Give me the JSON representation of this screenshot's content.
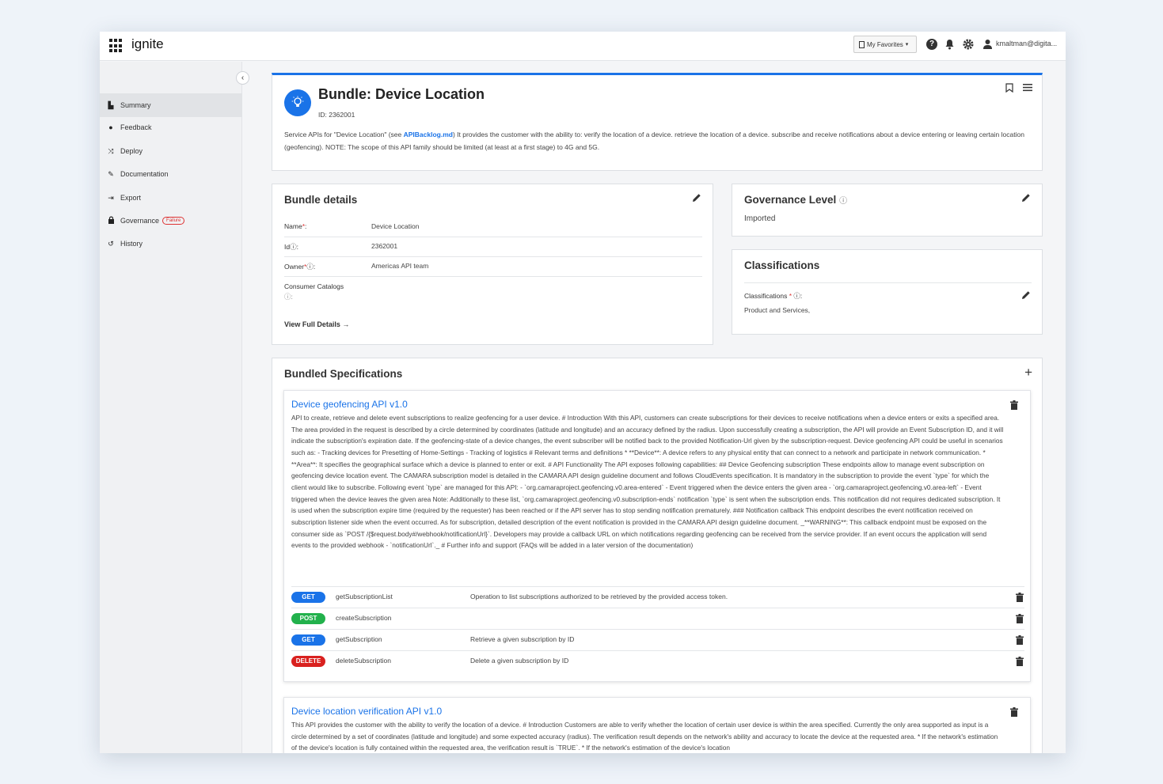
{
  "topbar": {
    "brand": "ignite",
    "favorites_label": "My Favorites",
    "user_name": "kmaltman@digita..."
  },
  "sidebar": {
    "items": [
      {
        "label": "Summary",
        "icon": "file-icon",
        "active": true
      },
      {
        "label": "Feedback",
        "icon": "comment-icon"
      },
      {
        "label": "Deploy",
        "icon": "shuffle-icon"
      },
      {
        "label": "Documentation",
        "icon": "paperclip-icon"
      },
      {
        "label": "Export",
        "icon": "export-icon"
      },
      {
        "label": "Governance",
        "icon": "lock-icon",
        "badge": "Failure"
      },
      {
        "label": "History",
        "icon": "history-icon"
      }
    ]
  },
  "hero": {
    "title": "Bundle: Device Location",
    "id_text": "ID: 2362001",
    "desc_prefix": "Service APIs for \"Device Location\" (see ",
    "desc_link": "APIBacklog.md",
    "desc_suffix": ") It provides the customer with the ability to: verify the location of a device. retrieve the location of a device. subscribe and receive notifications about a device entering or leaving certain location (geofencing). NOTE: The scope of this API family should be limited (at least at a first stage) to 4G and 5G."
  },
  "bundle_details": {
    "title": "Bundle details",
    "rows": [
      {
        "label": "Name",
        "required": "*",
        "help": "",
        "suffix": ":",
        "value": "Device Location"
      },
      {
        "label": "Id",
        "required": "",
        "help": "ⓘ",
        "suffix": ":",
        "value": "2362001"
      },
      {
        "label": "Owner",
        "required": "*",
        "help": "ⓘ",
        "suffix": ":",
        "value": "Americas API team"
      },
      {
        "label": "Consumer Catalogs",
        "required": "",
        "help": "ⓘ",
        "suffix": ":",
        "value": ""
      }
    ],
    "view_full": "View Full Details →"
  },
  "governance": {
    "title": "Governance Level",
    "help": "ⓘ",
    "value": "Imported"
  },
  "classifications": {
    "title": "Classifications",
    "label": "Classifications",
    "required": "*",
    "help": "ⓘ",
    "suffix": ":",
    "value": "Product and Services,"
  },
  "bundled_specs": {
    "title": "Bundled Specifications",
    "specs": [
      {
        "name": "Device geofencing API",
        "version": "v1.0",
        "description": "API to create, retrieve and delete event subscriptions to realize geofencing for a user device. # Introduction With this API, customers can create subscriptions for their devices to receive notifications when a device enters or exits a specified area. The area provided in the request is described by a circle determined by coordinates (latitude and longitude) and an accuracy defined by the radius. Upon successfully creating a subscription, the API will provide an Event Subscription ID, and it will indicate the subscription's expiration date. If the geofencing-state of a device changes, the event subscriber will be notified back to the provided Notification-Url given by the subscription-request. Device geofencing API could be useful in scenarios such as: - Tracking devices for Presetting of Home-Settings - Tracking of logistics # Relevant terms and definitions * **Device**: A device refers to any physical entity that can connect to a network and participate in network communication. * **Area**: It specifies the geographical surface which a device is planned to enter or exit. # API Functionality The API exposes following capabilities: ## Device Geofencing subscription These endpoints allow to manage event subscription on geofencing device location event. The CAMARA subscription model is detailed in the CAMARA API design guideline document and follows CloudEvents specification. It is mandatory in the subscription to provide the event `type` for which the client would like to subscribe. Following event `type` are managed for this API: - `org.camaraproject.geofencing.v0.area-entered` - Event triggered when the device enters the given area - `org.camaraproject.geofencing.v0.area-left` - Event triggered when the device leaves the given area Note: Additionally to these list, `org.camaraproject.geofencing.v0.subscription-ends` notification `type` is sent when the subscription ends. This notification did not requires dedicated subscription. It is used when the subscription expire time (required by the requester) has been reached or if the API server has to stop sending notification prematurely. ### Notification callback This endpoint describes the event notification received on subscription listener side when the event occurred. As for subscription, detailed description of the event notification is provided in the CAMARA API design guideline document. _**WARNING**: This callback endpoint must be exposed on the consumer side as `POST /{$request.body#/webhook/notificationUrl}`. Developers may provide a callback URL on which notifications regarding geofencing can be received from the service provider. If an event occurs the application will send events to the provided webhook - `notificationUrl`._ # Further info and support (FAQs will be added in a later version of the documentation)",
        "operations": [
          {
            "method": "GET",
            "name": "getSubscriptionList",
            "desc": "Operation to list subscriptions authorized to be retrieved by the provided access token."
          },
          {
            "method": "POST",
            "name": "createSubscription",
            "desc": ""
          },
          {
            "method": "GET",
            "name": "getSubscription",
            "desc": "Retrieve a given subscription by ID"
          },
          {
            "method": "DELETE",
            "name": "deleteSubscription",
            "desc": "Delete a given subscription by ID"
          }
        ]
      },
      {
        "name": "Device location verification API",
        "version": "v1.0",
        "description": "This API provides the customer with the ability to verify the location of a device. # Introduction Customers are able to verify whether the location of certain user device is within the area specified. Currently the only area supported as input is a circle determined by a set of coordinates (latitude and longitude) and some expected accuracy (radius). The verification result depends on the network's ability and accuracy to locate the device at the requested area. * If the network's estimation of the device's location is fully contained within the requested area, the verification result is `TRUE`. * If the network's estimation of the device's location"
      }
    ]
  },
  "colors": {
    "accent": "#1a73e8",
    "get": "#1a73e8",
    "post": "#22b14c",
    "delete": "#d9211f",
    "failure": "#dd3333"
  }
}
